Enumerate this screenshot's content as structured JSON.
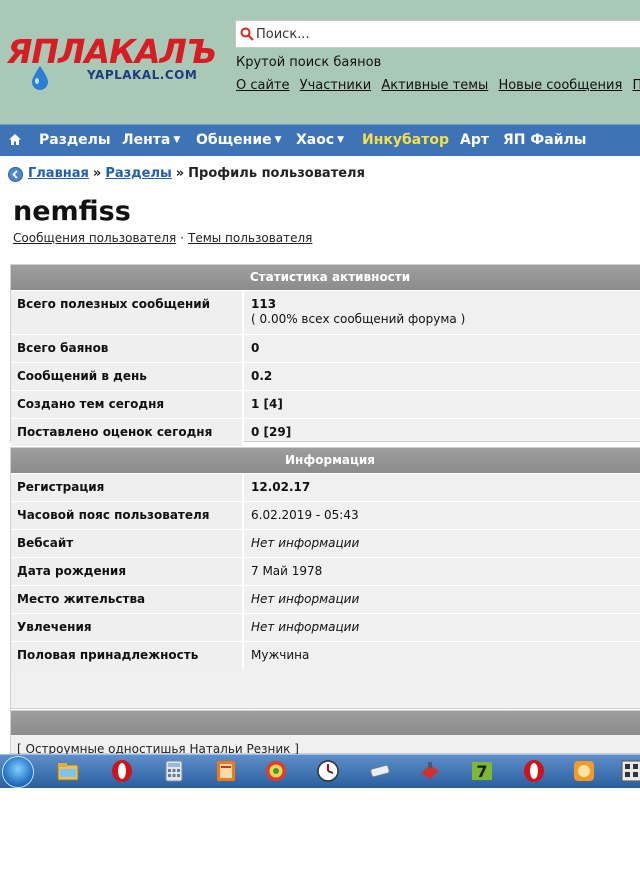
{
  "header": {
    "logo_text": "ЯПЛАКАЛЪ",
    "logo_sub": "YAPLAKAL.COM",
    "search_placeholder": "Поиск...",
    "tagline": "Крутой поиск баянов",
    "links": [
      "О сайте",
      "Участники",
      "Активные темы",
      "Новые сообщения",
      "По"
    ]
  },
  "nav": {
    "items": [
      {
        "label": "Разделы"
      },
      {
        "label": "Лента",
        "caret": "▼"
      },
      {
        "label": "Общение",
        "caret": "▼"
      },
      {
        "label": "Хаос",
        "caret": "▼"
      },
      {
        "label": "Инкубатор"
      },
      {
        "label": "Арт"
      },
      {
        "label": "ЯП Файлы"
      }
    ]
  },
  "breadcrumb": {
    "home": "Главная",
    "sep1": "»",
    "sections": "Разделы",
    "sep2": "»",
    "current": "Профиль пользователя"
  },
  "profile": {
    "username": "nemfiss",
    "link_posts": "Сообщения пользователя",
    "link_dot": "·",
    "link_topics": "Темы пользователя"
  },
  "activity": {
    "title": "Статистика активности",
    "rows": [
      {
        "label": "Всего полезных сообщений",
        "value": "113",
        "value2": "( 0.00% всех сообщений форума )"
      },
      {
        "label": "Всего баянов",
        "value": "0"
      },
      {
        "label": "Сообщений в день",
        "value": "0.2"
      },
      {
        "label": "Создано тем сегодня",
        "value": "1 [4]"
      },
      {
        "label": "Поставлено оценок сегодня",
        "value": "0 [29]"
      }
    ]
  },
  "info": {
    "title": "Информация",
    "rows": [
      {
        "label": "Регистрация",
        "value": "12.02.17"
      },
      {
        "label": "Часовой пояс пользователя",
        "value": "6.02.2019 - 05:43"
      },
      {
        "label": "Вебсайт",
        "value": "Нет информации"
      },
      {
        "label": "Дата рождения",
        "value": "7 Май 1978"
      },
      {
        "label": "Место жительства",
        "value": "Нет информации"
      },
      {
        "label": "Увлечения",
        "value": "Нет информации"
      },
      {
        "label": "Половая принадлежность",
        "value": "Мужчина"
      }
    ]
  },
  "signature": {
    "text": "[ Остроумные одностишья Натальи Резник ]"
  },
  "taskbar": {
    "icons": [
      "start-orb",
      "file-explorer",
      "opera",
      "calculator",
      "cl-app",
      "target-app",
      "clock-app",
      "eraser-app",
      "red-tool-app",
      "seven-zip",
      "opera-2",
      "orange-app",
      "grid-app"
    ]
  },
  "colors": {
    "header_bg": "#a9c9b6",
    "nav_bg": "#3f73b7",
    "incubator": "#f6e04a",
    "link": "#215fa8",
    "panel_head": "#949494"
  }
}
